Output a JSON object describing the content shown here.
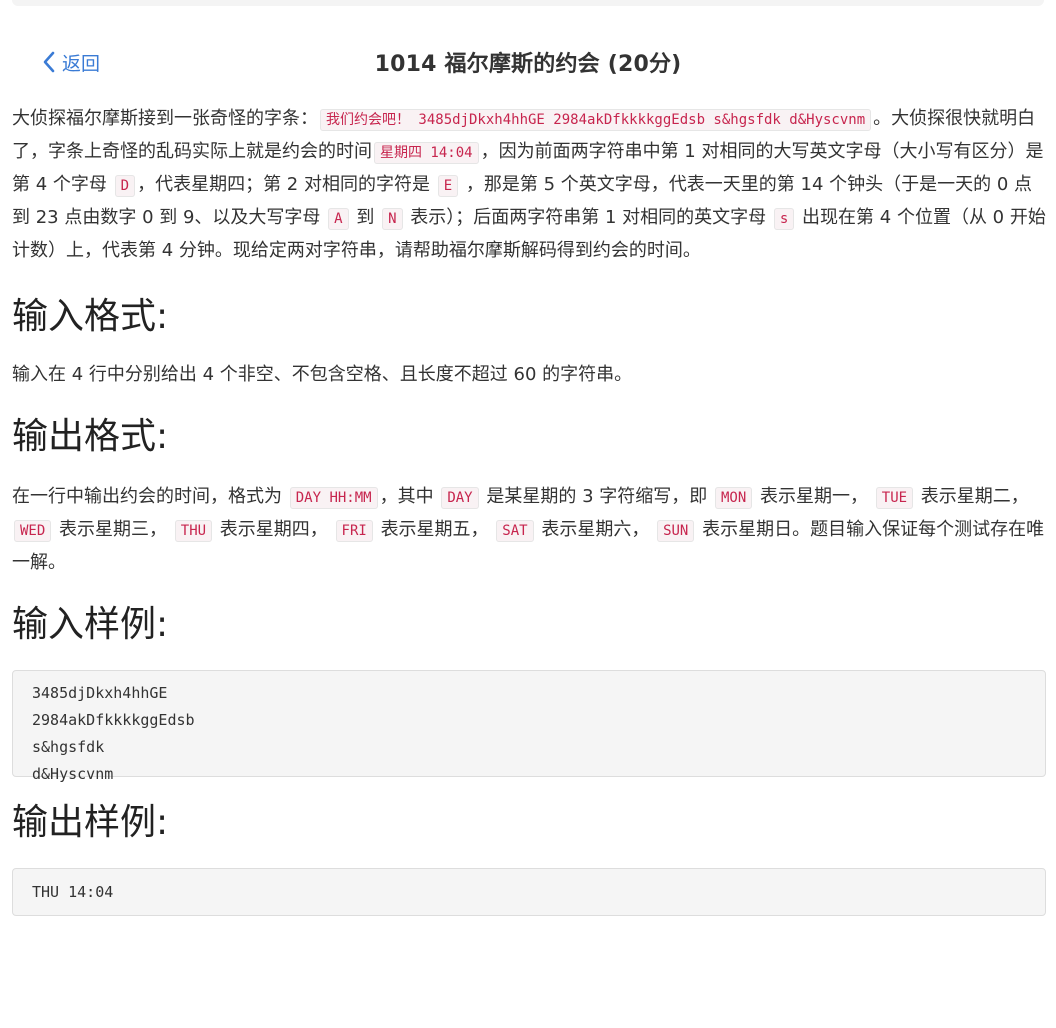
{
  "header": {
    "back_label": "返回",
    "title": "1014 福尔摩斯的约会 (20分)"
  },
  "description": {
    "t1": "大侦探福尔摩斯接到一张奇怪的字条：",
    "c1": "我们约会吧！ 3485djDkxh4hhGE 2984akDfkkkkggEdsb s&hgsfdk d&Hyscvnm",
    "t2": "。大侦探很快就明白了，字条上奇怪的乱码实际上就是约会的时间",
    "c2": "星期四 14:04",
    "t3": "，因为前面两字符串中第 1 对相同的大写英文字母（大小写有区分）是第 4 个字母",
    "c3": "D",
    "t4": "，代表星期四；第 2 对相同的字符是",
    "c4": "E",
    "t5": "，那是第 5 个英文字母，代表一天里的第 14 个钟头（于是一天的 0 点到 23 点由数字 0 到 9、以及大写字母",
    "c5": "A",
    "t6": "到",
    "c6": "N",
    "t7": "表示）；后面两字符串第 1 对相同的英文字母",
    "c7": "s",
    "t8": "出现在第 4 个位置（从 0 开始计数）上，代表第 4 分钟。现给定两对字符串，请帮助福尔摩斯解码得到约会的时间。"
  },
  "input_format": {
    "heading": "输入格式:",
    "text": "输入在 4 行中分别给出 4 个非空、不包含空格、且长度不超过 60 的字符串。"
  },
  "output_format": {
    "heading": "输出格式:",
    "t1": "在一行中输出约会的时间，格式为",
    "c1": "DAY HH:MM",
    "t2": "，其中",
    "c2": "DAY",
    "t3": "是某星期的 3 字符缩写，即",
    "c3": "MON",
    "t4": "表示星期一，",
    "c4": "TUE",
    "t5": "表示星期二，",
    "c5": "WED",
    "t6": "表示星期三，",
    "c6": "THU",
    "t7": "表示星期四，",
    "c7": "FRI",
    "t8": "表示星期五，",
    "c8": "SAT",
    "t9": "表示星期六，",
    "c9": "SUN",
    "t10": "表示星期日。题目输入保证每个测试存在唯一解。"
  },
  "sample_input": {
    "heading": "输入样例:",
    "code": "3485djDkxh4hhGE\n2984akDfkkkkggEdsb\ns&hgsfdk\nd&Hyscvnm"
  },
  "sample_output": {
    "heading": "输出样例:",
    "code": "THU 14:04"
  },
  "colors": {
    "link": "#3a7bd5",
    "code_text": "#c7254e",
    "code_bg": "#f9f2f4",
    "pre_bg": "#f5f5f5"
  },
  "icons": {
    "back": "chevron-left-icon"
  }
}
